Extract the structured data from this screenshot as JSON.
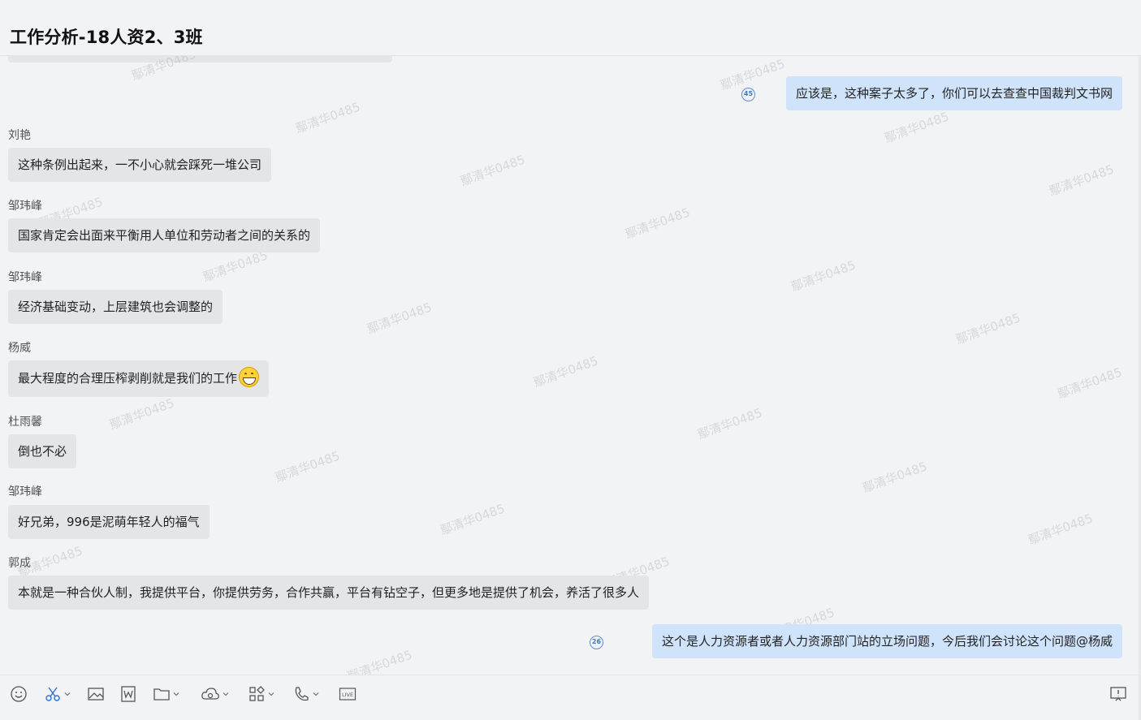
{
  "header": {
    "title": "工作分析-18人资2、3班"
  },
  "watermark": "鄢清华0485",
  "messages": [
    {
      "side": "right",
      "read_count": "45",
      "text": "应该是，这种案子太多了，你们可以去查查中国裁判文书网"
    },
    {
      "side": "left",
      "sender": "刘艳",
      "text": "这种条例出起来，一不小心就会踩死一堆公司"
    },
    {
      "side": "left",
      "sender": "邹玮峰",
      "text": "国家肯定会出面来平衡用人单位和劳动者之间的关系的"
    },
    {
      "side": "left",
      "sender": "邹玮峰",
      "text": "经济基础变动，上层建筑也会调整的"
    },
    {
      "side": "left",
      "sender": "杨威",
      "text": "最大程度的合理压榨剥削就是我们的工作",
      "emoji": "grinning-face-icon"
    },
    {
      "side": "left",
      "sender": "杜雨馨",
      "text": "倒也不必"
    },
    {
      "side": "left",
      "sender": "邹玮峰",
      "text": "好兄弟，996是泥萌年轻人的福气"
    },
    {
      "side": "left",
      "sender": "郭成",
      "text": "本就是一种合伙人制，我提供平台，你提供劳务，合作共赢，平台有钻空子，但更多地是提供了机会，养活了很多人"
    },
    {
      "side": "right",
      "read_count": "26",
      "text": "这个是人力资源者或者人力资源部门站的立场问题，今后我们会讨论这个问题@杨威"
    }
  ],
  "toolbar": {
    "icons": [
      "emoji-icon",
      "scissors-icon",
      "image-icon",
      "word-doc-icon",
      "folder-icon",
      "cloud-icon",
      "apps-icon",
      "phone-icon",
      "live-icon",
      "screen-share-icon"
    ],
    "live_label": "LIVE"
  },
  "colors": {
    "accent": "#3f75c7",
    "bubble_self": "#cfe3fb",
    "bubble_other": "#e4e5e7",
    "background": "#f2f3f5"
  }
}
